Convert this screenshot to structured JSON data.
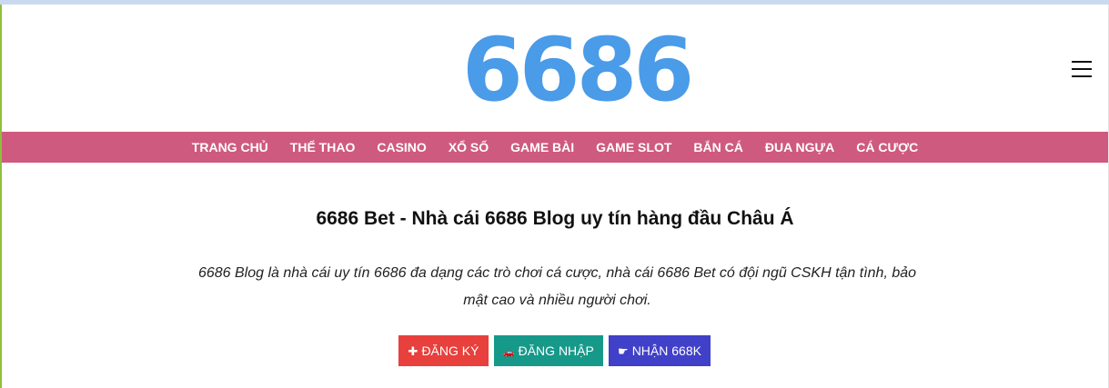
{
  "header": {
    "logo_text": "6686",
    "logo_color": "#4a9be8",
    "menu_icon": "hamburger-menu-icon"
  },
  "nav": {
    "bg_color": "#cf5a7f",
    "items": [
      {
        "label": "TRANG CHỦ"
      },
      {
        "label": "THỂ THAO"
      },
      {
        "label": "CASINO"
      },
      {
        "label": "XỔ SỐ"
      },
      {
        "label": "GAME BÀI"
      },
      {
        "label": "GAME SLOT"
      },
      {
        "label": "BẮN CÁ"
      },
      {
        "label": "ĐUA NGỰA"
      },
      {
        "label": "CÁ CƯỢC"
      }
    ]
  },
  "main": {
    "title": "6686 Bet - Nhà cái 6686 Blog uy tín hàng đầu Châu Á",
    "intro_line1": "6686 Blog là nhà cái uy tín 6686 đa dạng các trò chơi cá cược, nhà cái 6686 Bet có đội ngũ CSKH tận tình, bảo",
    "intro_line2": "mật cao và nhiều người chơi."
  },
  "cta": {
    "register": {
      "icon": "✚",
      "label": "ĐĂNG KÝ",
      "color": "#e8403c"
    },
    "login": {
      "icon": "🚗",
      "label": "ĐĂNG NHẬP",
      "color": "#17998a"
    },
    "bonus": {
      "icon": "☛",
      "label": "NHẬN 668K",
      "color": "#4040c8"
    }
  }
}
